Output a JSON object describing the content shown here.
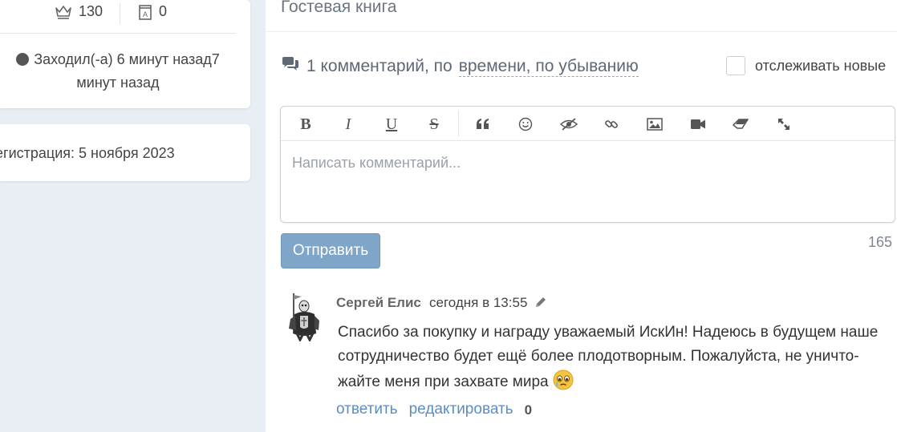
{
  "sidebar": {
    "stats": {
      "followers": "130",
      "docs": "0"
    },
    "last_seen": {
      "line1": "Заходил(-а) 6 минут назад7",
      "line2": "минут назад"
    },
    "registration": "егистрация: 5 ноября 2023"
  },
  "guestbook": {
    "title": "Гостевая книга",
    "comments_count": "1 комментарий, по",
    "sort_label": "времени, по убыванию",
    "follow_label": "отслеживать новые"
  },
  "editor": {
    "toolbar": [
      {
        "name": "bold-button",
        "glyph": "B"
      },
      {
        "name": "italic-button",
        "glyph": "I"
      },
      {
        "name": "underline-button",
        "glyph": "U"
      },
      {
        "name": "strikethrough-button",
        "glyph": "S"
      },
      {
        "name": "quote-button",
        "icon": "quote-icon"
      },
      {
        "name": "emoji-button",
        "icon": "smile-icon"
      },
      {
        "name": "spoiler-button",
        "icon": "eye-slash-icon"
      },
      {
        "name": "link-button",
        "icon": "link-icon"
      },
      {
        "name": "image-button",
        "icon": "image-icon"
      },
      {
        "name": "video-button",
        "icon": "video-icon"
      },
      {
        "name": "clear-format-button",
        "icon": "eraser-icon"
      },
      {
        "name": "fullscreen-button",
        "icon": "expand-icon"
      }
    ],
    "placeholder": "Написать комментарий...",
    "submit_label": "Отправить",
    "char_count": "165"
  },
  "comment": {
    "author": "Сергей Елис",
    "time": "сегодня в 13:55",
    "text": "Спасибо за покупку и награду уважаемый ИскИн! Надеюсь в будущем наше сотрудничество будет ещё более плодотворным. Пожалуйста, не уничто­жайте меня при захвате мира",
    "reply_label": "ответить",
    "edit_label": "редактировать",
    "votes": "0"
  },
  "colors": {
    "background": "#e9eef4",
    "submit_button": "#7fa5c8",
    "link": "#5a8ec2"
  }
}
